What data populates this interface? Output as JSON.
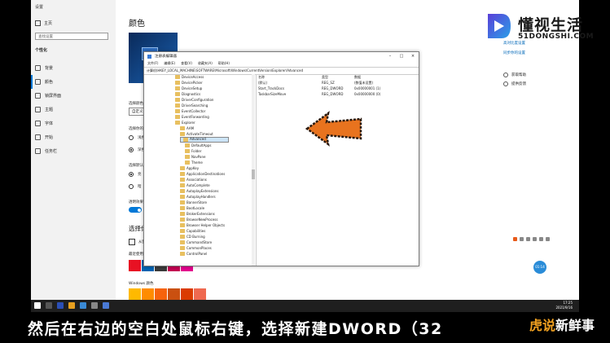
{
  "settings": {
    "title": "设置",
    "home": "主页",
    "search_placeholder": "查找设置",
    "group": "个性化",
    "nav": [
      "背景",
      "颜色",
      "锁屏界面",
      "主题",
      "字体",
      "开始",
      "任务栏"
    ],
    "page_title": "颜色",
    "choose_color_label": "选择颜色",
    "choose_color_value": "自定义",
    "default_windows_mode_label": "选择你的默认 Windows 模式",
    "windows_mode_options": [
      "浅色",
      "深色"
    ],
    "default_app_mode_label": "选择默认应用模式",
    "app_mode_options": [
      "亮",
      "暗"
    ],
    "transparency_label": "透明效果",
    "transparency_value": "开",
    "accent_heading": "选择你的主题色",
    "auto_accent": "从我的背景自动选取",
    "recent_colors_label": "最近使用的颜色",
    "windows_colors_label": "Windows 颜色",
    "recent_colors": [
      "#e81123",
      "#0063b1",
      "#3a3a3a",
      "#c30052",
      "#e3008c"
    ],
    "right_links": [
      "高对比度设置",
      "同步你的设置"
    ],
    "support": [
      "获取帮助",
      "提供反馈"
    ],
    "bubble_time": "01:14"
  },
  "registry": {
    "title": "注册表编辑器",
    "menu": [
      "文件(F)",
      "编辑(E)",
      "查看(V)",
      "收藏夹(A)",
      "帮助(H)"
    ],
    "address": "计算机\\HKEY_LOCAL_MACHINE\\SOFTWARE\\Microsoft\\Windows\\CurrentVersion\\Explorer\\Advanced",
    "tree": [
      "DeviceAccess",
      "DevicePicker",
      "DeviceSetup",
      "Diagnostics",
      "DriverConfiguration",
      "DriverSearching",
      "EventCollector",
      "EventForwarding",
      "Explorer",
      "AAM",
      "ActivateTimeout",
      "Advanced",
      "DefaultApps",
      "Folder",
      "NavPane",
      "Theme",
      "AppKey",
      "ApplicationDestinations",
      "Associations",
      "AutoComplete",
      "AutoplayExtensions",
      "AutoplayHandlers",
      "BannerStore",
      "BootLocale",
      "BrokerExtensions",
      "BrowseNewProcess",
      "Browser Helper Objects",
      "Capabilities",
      "CD Burning",
      "CommandStore",
      "CommonPlaces",
      "ControlPanel"
    ],
    "columns": [
      "名称",
      "类型",
      "数据"
    ],
    "values": [
      {
        "name": "(默认)",
        "type": "REG_SZ",
        "data": "(数值未设置)"
      },
      {
        "name": "Start_TrackDocs",
        "type": "REG_DWORD",
        "data": "0x00000001 (1)"
      },
      {
        "name": "TaskbarSizeMove",
        "type": "REG_DWORD",
        "data": "0x00000000 (0)"
      }
    ]
  },
  "taskbar": {
    "time": "17:25",
    "date": "2021/9/16"
  },
  "logo": {
    "name": "懂视生活",
    "url": "51DONGSHI.COM"
  },
  "subtitle": "然后在右边的空白处鼠标右键，选择新建DWORD（32",
  "brand2": {
    "part1": "虎说",
    "part2": "新鲜事"
  },
  "colors": {
    "accent": "#0078d7",
    "arrow": "#e8731e",
    "folder": "#e8c060"
  }
}
